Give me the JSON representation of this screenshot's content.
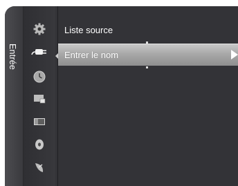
{
  "tab": {
    "label": "Entrée"
  },
  "sidebar_icons": [
    "gear-icon",
    "plug-icon",
    "clock-icon",
    "picture-in-picture-icon",
    "screen-icon",
    "disc-icon",
    "satellite-dish-icon"
  ],
  "menu": {
    "items": [
      {
        "label": "Liste source",
        "selected": false
      },
      {
        "label": "Entrer le nom",
        "selected": true,
        "has_submenu": true
      }
    ]
  },
  "colors": {
    "panel": "#333337",
    "highlight": "#b0b0b0",
    "text": "#ffffff"
  }
}
